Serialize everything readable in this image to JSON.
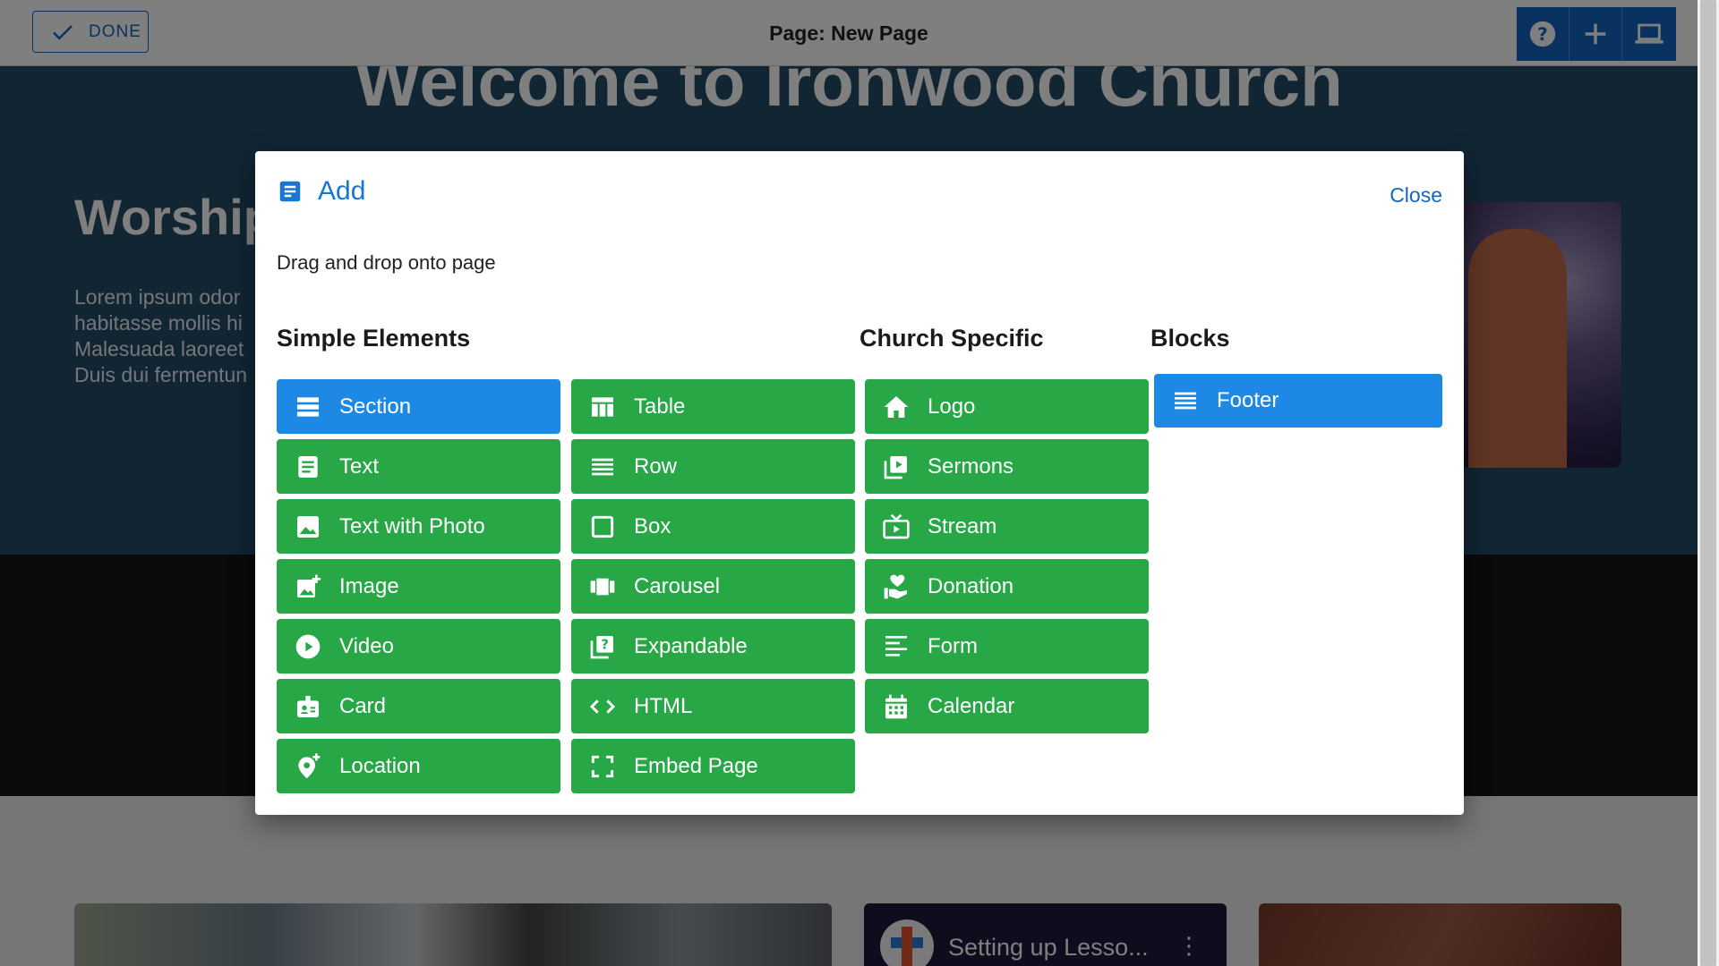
{
  "topbar": {
    "done_label": "DONE",
    "page_title": "Page: New Page",
    "tools": [
      "help-icon",
      "plus-icon",
      "laptop-icon"
    ]
  },
  "background": {
    "hero_title": "Welcome to Ironwood Church",
    "worship_heading": "Worship",
    "paragraph_lines": [
      "Lorem ipsum odor",
      "habitasse mollis hi",
      "Malesuada laoreet",
      "Duis dui fermentun"
    ],
    "video_title": "Setting up Lesso...",
    "video_menu": "⋮"
  },
  "dialog": {
    "title": "Add",
    "close_label": "Close",
    "instructions": "Drag and drop onto page",
    "sections": {
      "simple": "Simple Elements",
      "church": "Church Specific",
      "blocks": "Blocks"
    },
    "simple_col1": [
      {
        "label": "Section",
        "icon": "section-icon",
        "color": "#1e88e5"
      },
      {
        "label": "Text",
        "icon": "text-icon",
        "color": "#27a745"
      },
      {
        "label": "Text with Photo",
        "icon": "photo-icon",
        "color": "#27a745"
      },
      {
        "label": "Image",
        "icon": "add-image-icon",
        "color": "#27a745"
      },
      {
        "label": "Video",
        "icon": "play-icon",
        "color": "#27a745"
      },
      {
        "label": "Card",
        "icon": "badge-icon",
        "color": "#27a745"
      },
      {
        "label": "Location",
        "icon": "add-location-icon",
        "color": "#27a745"
      }
    ],
    "simple_col2": [
      {
        "label": "Table",
        "icon": "table-icon",
        "color": "#27a745"
      },
      {
        "label": "Row",
        "icon": "row-icon",
        "color": "#27a745"
      },
      {
        "label": "Box",
        "icon": "box-icon",
        "color": "#27a745"
      },
      {
        "label": "Carousel",
        "icon": "carousel-icon",
        "color": "#27a745"
      },
      {
        "label": "Expandable",
        "icon": "question-library-icon",
        "color": "#27a745"
      },
      {
        "label": "HTML",
        "icon": "code-icon",
        "color": "#27a745"
      },
      {
        "label": "Embed Page",
        "icon": "fullscreen-icon",
        "color": "#27a745"
      }
    ],
    "church": [
      {
        "label": "Logo",
        "icon": "home-icon",
        "color": "#27a745"
      },
      {
        "label": "Sermons",
        "icon": "video-library-icon",
        "color": "#27a745"
      },
      {
        "label": "Stream",
        "icon": "live-tv-icon",
        "color": "#27a745"
      },
      {
        "label": "Donation",
        "icon": "volunteer-icon",
        "color": "#27a745"
      },
      {
        "label": "Form",
        "icon": "form-icon",
        "color": "#27a745"
      },
      {
        "label": "Calendar",
        "icon": "calendar-icon",
        "color": "#27a745"
      }
    ],
    "blocks": [
      {
        "label": "Footer",
        "icon": "footer-icon",
        "color": "#1e88e5"
      }
    ]
  }
}
